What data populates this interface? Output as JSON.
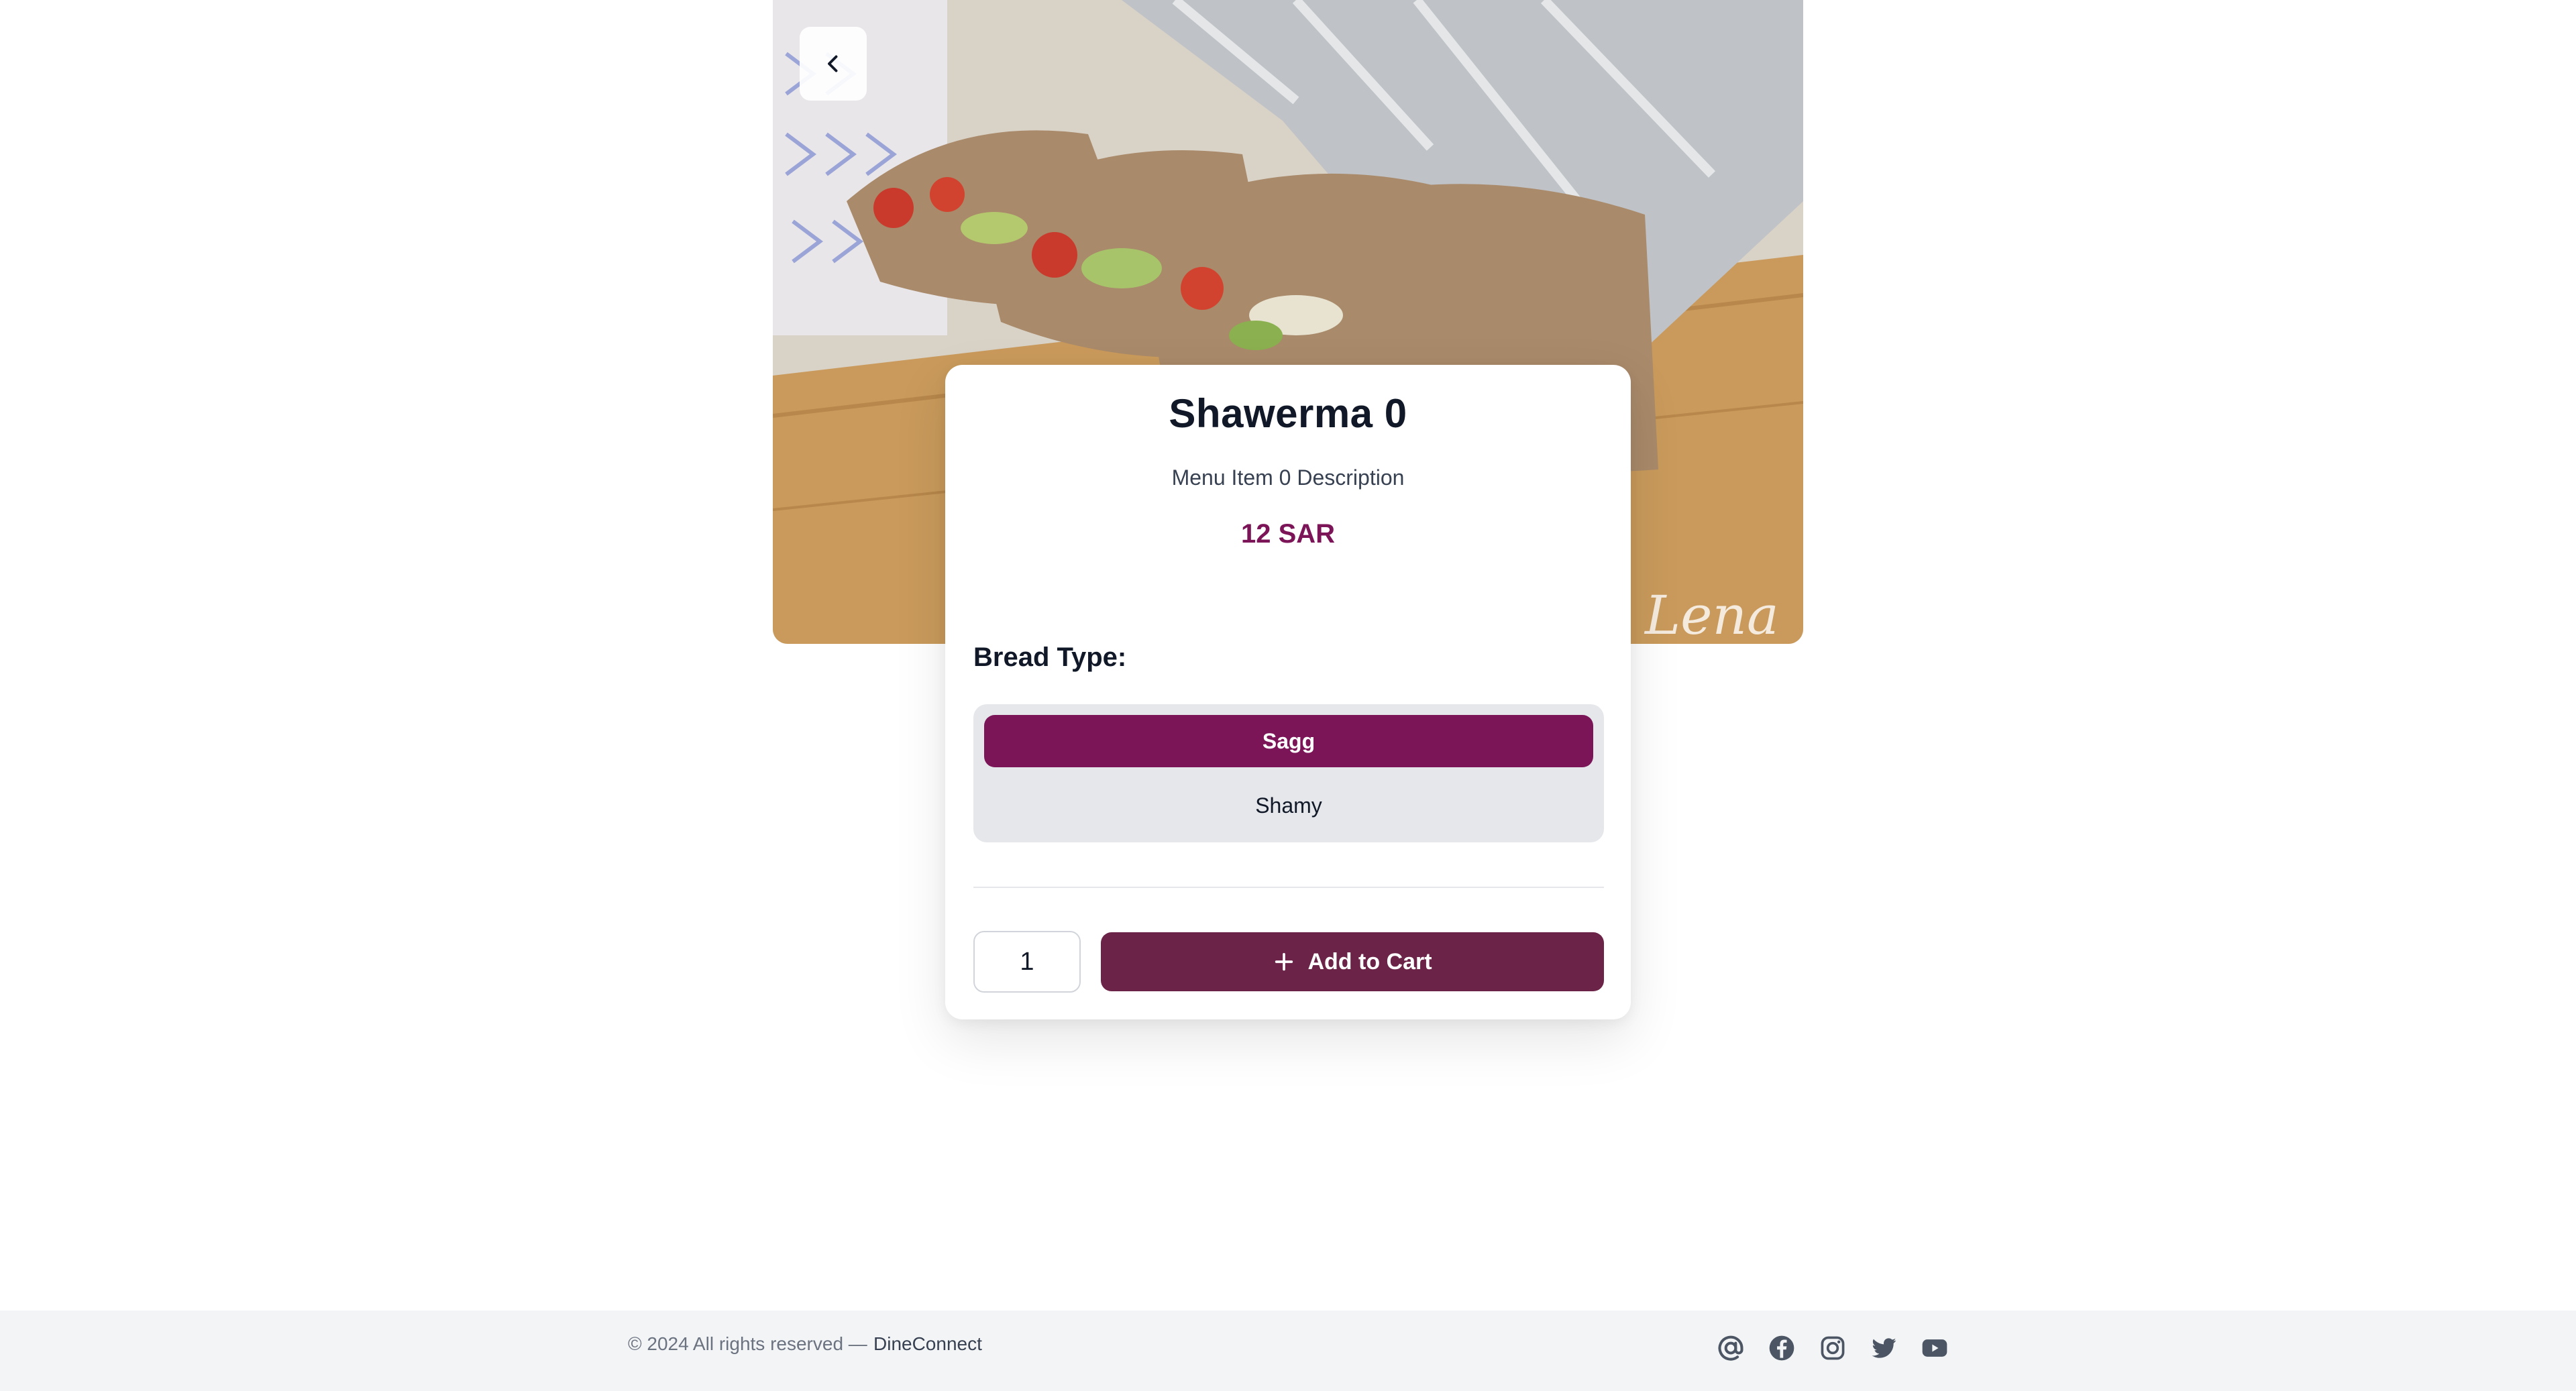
{
  "item": {
    "title": "Shawerma 0",
    "description": "Menu Item 0 Description",
    "price": "12 SAR"
  },
  "options": {
    "label": "Bread Type:",
    "choices": [
      "Sagg",
      "Shamy"
    ],
    "selected": "Sagg"
  },
  "cart": {
    "quantity": "1",
    "add_label": "Add to Cart"
  },
  "footer": {
    "copyright": "© 2024 All rights reserved —",
    "brand": "DineConnect",
    "social_icons": [
      "at-icon",
      "facebook-icon",
      "instagram-icon",
      "twitter-icon",
      "youtube-icon"
    ]
  },
  "colors": {
    "accent": "#7b1558",
    "button": "#6b2347",
    "footer_bg": "#f3f4f6"
  }
}
